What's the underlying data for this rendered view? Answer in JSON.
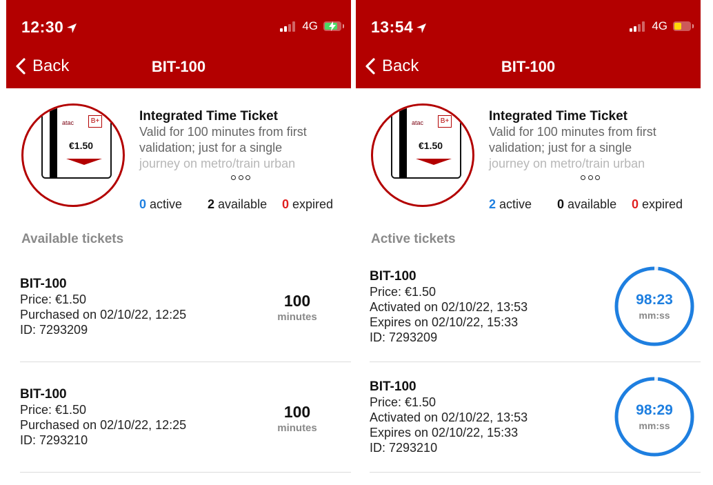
{
  "colors": {
    "brand": "#b30000",
    "active": "#1e7fe0",
    "expired": "#e02020",
    "timer": "#1e7fe0"
  },
  "screens": [
    {
      "status": {
        "time": "12:30",
        "network": "4G",
        "battery_charging": true,
        "battery_level": 0.85
      },
      "nav": {
        "back_label": "Back",
        "title": "BIT-100"
      },
      "ticket": {
        "card_logo": "atac",
        "card_badge": "B+",
        "card_price": "€1.50",
        "title": "Integrated Time Ticket",
        "desc_line1": "Valid for 100 minutes from first",
        "desc_line2": "validation; just for a single",
        "desc_line3": "journey on metro/train urban",
        "more_icon": "ellipsis-icon"
      },
      "counts": {
        "active": "0",
        "available": "2",
        "expired": "0",
        "active_label": "active",
        "available_label": "available",
        "expired_label": "expired"
      },
      "section_title": "Available tickets",
      "tickets": [
        {
          "name": "BIT-100",
          "price": "Price: €1.50",
          "purchased": "Purchased on 02/10/22, 12:25",
          "id": "ID: 7293209",
          "duration": "100",
          "duration_unit": "minutes"
        },
        {
          "name": "BIT-100",
          "price": "Price: €1.50",
          "purchased": "Purchased on 02/10/22, 12:25",
          "id": "ID: 7293210",
          "duration": "100",
          "duration_unit": "minutes"
        }
      ]
    },
    {
      "status": {
        "time": "13:54",
        "network": "4G",
        "battery_charging": false,
        "battery_level": 0.45
      },
      "nav": {
        "back_label": "Back",
        "title": "BIT-100"
      },
      "ticket": {
        "card_logo": "atac",
        "card_badge": "B+",
        "card_price": "€1.50",
        "title": "Integrated Time Ticket",
        "desc_line1": "Valid for 100 minutes from first",
        "desc_line2": "validation; just for a single",
        "desc_line3": "journey on metro/train urban",
        "more_icon": "ellipsis-icon"
      },
      "counts": {
        "active": "2",
        "available": "0",
        "expired": "0",
        "active_label": "active",
        "available_label": "available",
        "expired_label": "expired"
      },
      "section_title": "Active tickets",
      "tickets": [
        {
          "name": "BIT-100",
          "price": "Price: €1.50",
          "activated": "Activated on 02/10/22, 13:53",
          "expires": "Expires on 02/10/22, 15:33",
          "id": "ID: 7293209",
          "timer": "98:23",
          "timer_unit": "mm:ss",
          "remaining_fraction": 0.984
        },
        {
          "name": "BIT-100",
          "price": "Price: €1.50",
          "activated": "Activated on 02/10/22, 13:53",
          "expires": "Expires on 02/10/22, 15:33",
          "id": "ID: 7293210",
          "timer": "98:29",
          "timer_unit": "mm:ss",
          "remaining_fraction": 0.985
        }
      ]
    }
  ]
}
